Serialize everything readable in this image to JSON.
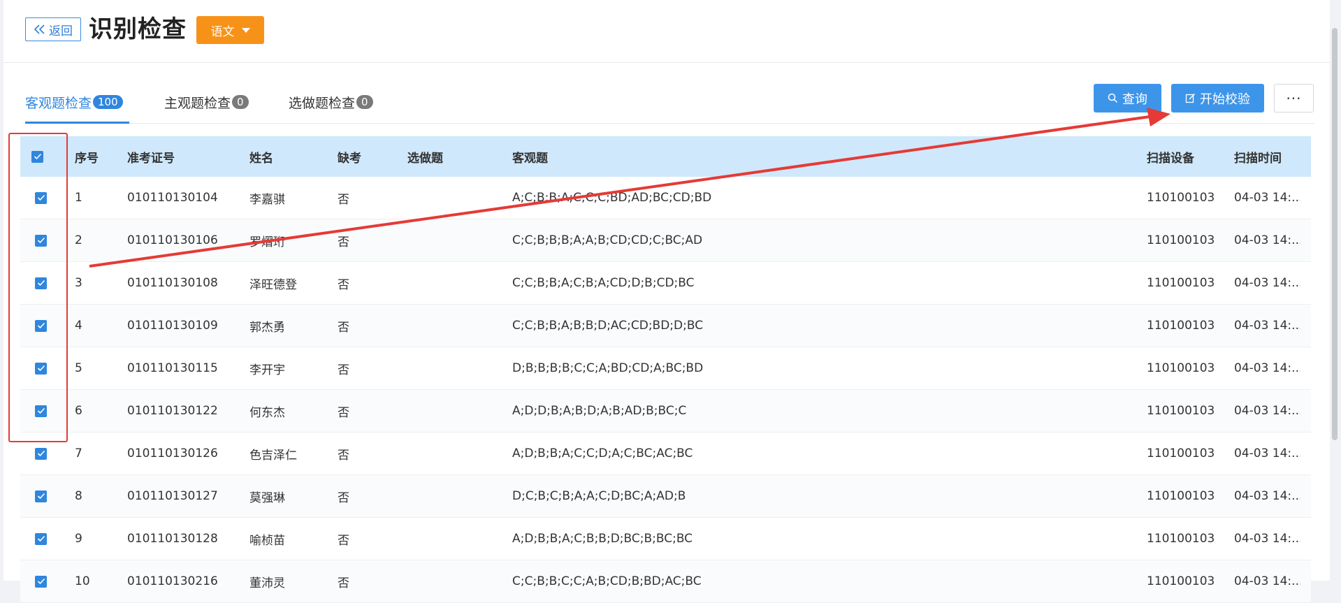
{
  "header": {
    "back_label": "返回",
    "title": "识别检查",
    "subject": "语文"
  },
  "tabs": [
    {
      "label": "客观题检查",
      "count": "100",
      "active": true
    },
    {
      "label": "主观题检查",
      "count": "0",
      "active": false
    },
    {
      "label": "选做题检查",
      "count": "0",
      "active": false
    }
  ],
  "toolbar": {
    "query_label": "查询",
    "start_label": "开始校验",
    "more_label": "···"
  },
  "table": {
    "columns": [
      "序号",
      "准考证号",
      "姓名",
      "缺考",
      "选做题",
      "客观题",
      "扫描设备",
      "扫描时间"
    ],
    "rows": [
      {
        "no": "1",
        "id": "010110130104",
        "name": "李嘉骐",
        "absent": "否",
        "optional": "",
        "objective": "A;C;B;B;A;C;C;C;BD;AD;BC;CD;BD",
        "device": "110100103",
        "time": "04-03 14:..."
      },
      {
        "no": "2",
        "id": "010110130106",
        "name": "罗熠珩",
        "absent": "否",
        "optional": "",
        "objective": "C;C;B;B;B;A;A;B;CD;CD;C;BC;AD",
        "device": "110100103",
        "time": "04-03 14:..."
      },
      {
        "no": "3",
        "id": "010110130108",
        "name": "泽旺德登",
        "absent": "否",
        "optional": "",
        "objective": "C;C;B;B;A;C;B;A;CD;D;B;CD;BC",
        "device": "110100103",
        "time": "04-03 14:..."
      },
      {
        "no": "4",
        "id": "010110130109",
        "name": "郭杰勇",
        "absent": "否",
        "optional": "",
        "objective": "C;C;B;B;A;B;B;D;AC;CD;BD;D;BC",
        "device": "110100103",
        "time": "04-03 14:..."
      },
      {
        "no": "5",
        "id": "010110130115",
        "name": "李开宇",
        "absent": "否",
        "optional": "",
        "objective": "D;B;B;B;B;C;C;A;BD;CD;A;BC;BD",
        "device": "110100103",
        "time": "04-03 14:..."
      },
      {
        "no": "6",
        "id": "010110130122",
        "name": "何东杰",
        "absent": "否",
        "optional": "",
        "objective": "A;D;D;B;A;B;D;A;B;AD;B;BC;C",
        "device": "110100103",
        "time": "04-03 14:..."
      },
      {
        "no": "7",
        "id": "010110130126",
        "name": "色吉泽仁",
        "absent": "否",
        "optional": "",
        "objective": "A;D;B;B;A;C;C;D;A;C;BC;AC;BC",
        "device": "110100103",
        "time": "04-03 14:..."
      },
      {
        "no": "8",
        "id": "010110130127",
        "name": "莫强琳",
        "absent": "否",
        "optional": "",
        "objective": "D;C;B;C;B;A;A;C;D;BC;A;AD;B",
        "device": "110100103",
        "time": "04-03 14:..."
      },
      {
        "no": "9",
        "id": "010110130128",
        "name": "喻桢苗",
        "absent": "否",
        "optional": "",
        "objective": "A;D;B;B;A;C;B;B;D;BC;B;BC;BC",
        "device": "110100103",
        "time": "04-03 14:..."
      },
      {
        "no": "10",
        "id": "010110130216",
        "name": "董沛灵",
        "absent": "否",
        "optional": "",
        "objective": "C;C;B;B;C;C;A;B;CD;B;BD;AC;BC",
        "device": "110100103",
        "time": "04-03 14:..."
      }
    ]
  },
  "colors": {
    "primary": "#2f86dd",
    "button": "#3d95ea",
    "subject_button": "#f79219",
    "header_row": "#cfe8fb",
    "annotation": "#e53a36"
  }
}
